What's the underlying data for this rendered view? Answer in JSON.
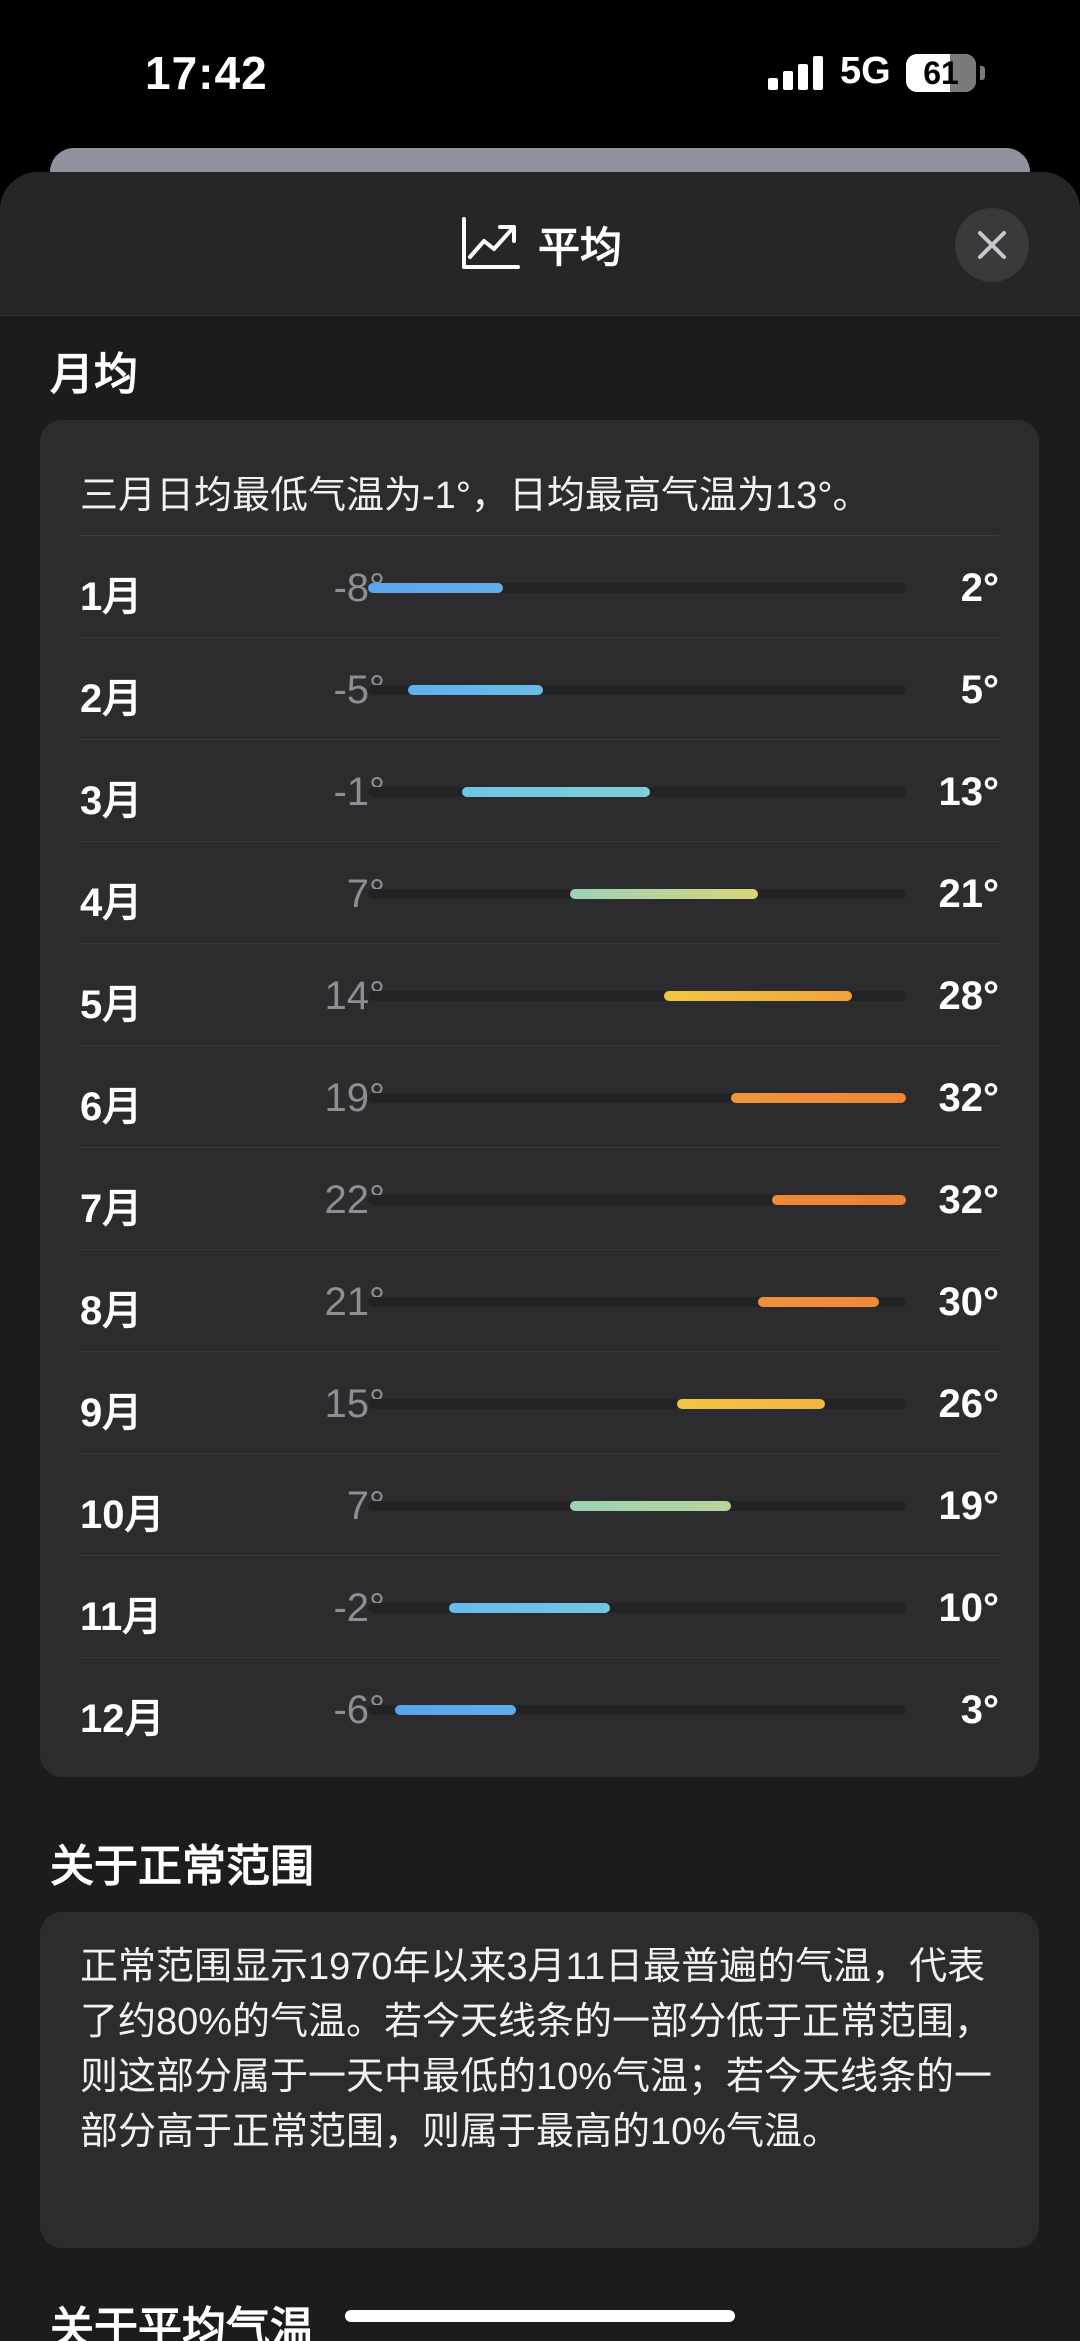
{
  "status_bar": {
    "time": "17:42",
    "network": "5G",
    "battery": "61"
  },
  "sheet": {
    "title": "平均",
    "title_icon": "chart-line-up-icon",
    "close_icon": "close-icon"
  },
  "monthly": {
    "section_title": "月均",
    "summary": "三月日均最低气温为-1°，日均最高气温为13°。",
    "scale": {
      "min": -8,
      "max": 32
    },
    "rows": [
      {
        "month": "1月",
        "low_label": "-8°",
        "high_label": "2°",
        "low": -8,
        "high": 2,
        "color_start": "#5aa6ec",
        "color_end": "#62aee9"
      },
      {
        "month": "2月",
        "low_label": "-5°",
        "high_label": "5°",
        "low": -5,
        "high": 5,
        "color_start": "#5fb0ee",
        "color_end": "#68bde6"
      },
      {
        "month": "3月",
        "low_label": "-1°",
        "high_label": "13°",
        "low": -1,
        "high": 13,
        "color_start": "#6cc6e8",
        "color_end": "#7fcfd6"
      },
      {
        "month": "4月",
        "low_label": "7°",
        "high_label": "21°",
        "low": 7,
        "high": 21,
        "color_start": "#9bd3b7",
        "color_end": "#d9d47a"
      },
      {
        "month": "5月",
        "low_label": "14°",
        "high_label": "28°",
        "low": 14,
        "high": 28,
        "color_start": "#f2c745",
        "color_end": "#f0a23c"
      },
      {
        "month": "6月",
        "low_label": "19°",
        "high_label": "32°",
        "low": 19,
        "high": 32,
        "color_start": "#f0953a",
        "color_end": "#ee8636"
      },
      {
        "month": "7月",
        "low_label": "22°",
        "high_label": "32°",
        "low": 22,
        "high": 32,
        "color_start": "#ee8a38",
        "color_end": "#ec8236"
      },
      {
        "month": "8月",
        "low_label": "21°",
        "high_label": "30°",
        "low": 21,
        "high": 30,
        "color_start": "#ef913a",
        "color_end": "#ee8a38"
      },
      {
        "month": "9月",
        "low_label": "15°",
        "high_label": "26°",
        "low": 15,
        "high": 26,
        "color_start": "#f3c445",
        "color_end": "#f2b540"
      },
      {
        "month": "10月",
        "low_label": "7°",
        "high_label": "19°",
        "low": 7,
        "high": 19,
        "color_start": "#9dd2b2",
        "color_end": "#b5d59c"
      },
      {
        "month": "11月",
        "low_label": "-2°",
        "high_label": "10°",
        "low": -2,
        "high": 10,
        "color_start": "#66bdec",
        "color_end": "#72c7e2"
      },
      {
        "month": "12月",
        "low_label": "-6°",
        "high_label": "3°",
        "low": -6,
        "high": 3,
        "color_start": "#58a4ec",
        "color_end": "#60acea"
      }
    ]
  },
  "normal_range": {
    "section_title": "关于正常范围",
    "body": "正常范围显示1970年以来3月11日最普遍的气温，代表了约80%的气温。若今天线条的一部分低于正常范围，则这部分属于一天中最低的10%气温；若今天线条的一部分高于正常范围，则属于最高的10%气温。"
  },
  "next_section": {
    "section_title": "关于平均气温"
  }
}
